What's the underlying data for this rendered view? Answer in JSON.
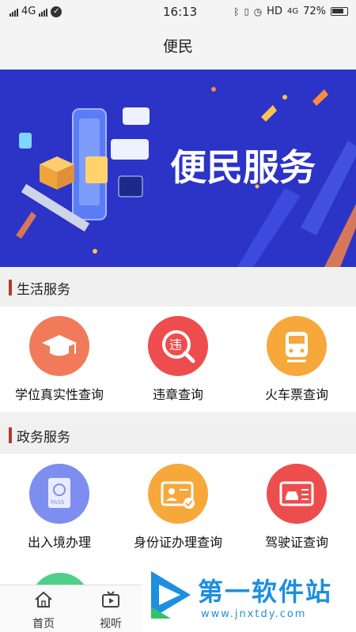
{
  "status_bar": {
    "network": "4G",
    "time": "16:13",
    "hd_label": "HD",
    "net2": "4G",
    "battery": "72%"
  },
  "header": {
    "title": "便民"
  },
  "banner": {
    "text": "便民服务"
  },
  "sections": {
    "life": {
      "title": "生活服务",
      "items": [
        {
          "label": "学位真实性查询",
          "icon": "graduation-cap-icon",
          "color": "#f07a5a"
        },
        {
          "label": "违章查询",
          "icon": "traffic-violation-icon",
          "color": "#ee4d4d"
        },
        {
          "label": "火车票查询",
          "icon": "train-icon",
          "color": "#f6a83b"
        }
      ]
    },
    "gov": {
      "title": "政务服务",
      "items": [
        {
          "label": "出入境办理",
          "icon": "passport-icon",
          "color": "#7d8ef0"
        },
        {
          "label": "身份证办理查询",
          "icon": "id-card-icon",
          "color": "#f6a83b"
        },
        {
          "label": "驾驶证查询",
          "icon": "driver-license-icon",
          "color": "#ee4d4d"
        }
      ]
    }
  },
  "nav": {
    "home": "首页",
    "video": "视听"
  },
  "watermark": {
    "title": "第一软件站",
    "url": "www.jnxtdy.com"
  },
  "colors": {
    "accent_bar": "#b23a2a",
    "banner_bg": "#2b34c6",
    "peek_green": "#4fd08a"
  }
}
